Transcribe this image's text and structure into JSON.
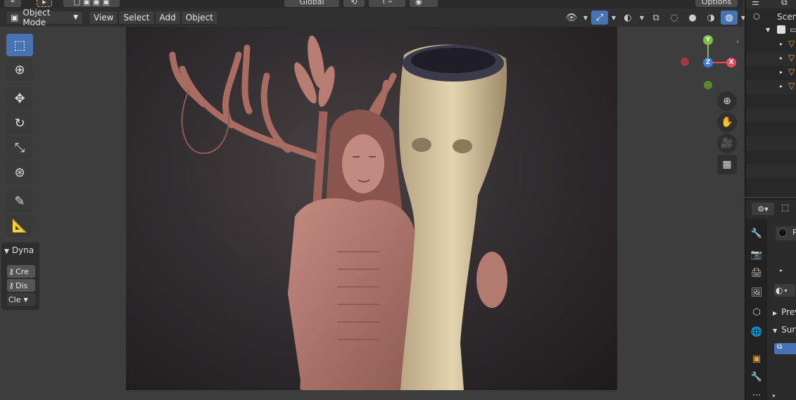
{
  "top_strip": {
    "transform_label": "Global",
    "options_label": "Options"
  },
  "header": {
    "mode_label": "Object Mode",
    "menus": [
      "View",
      "Select",
      "Add",
      "Object"
    ]
  },
  "toolbar": {
    "tools": [
      "select-box",
      "cursor",
      "move",
      "rotate",
      "scale",
      "transform",
      "annotate",
      "measure"
    ],
    "active_tool": "select-box"
  },
  "operator_panel": {
    "title": "Dyna",
    "buttons": [
      "Cre",
      "Dis"
    ],
    "dropdown": "Cle"
  },
  "gizmo": {
    "y_label": "Y",
    "z_label": "Z",
    "x_label": "X",
    "colors": {
      "x": "#e84a5f",
      "y": "#7bc043",
      "z": "#3b7dd8"
    }
  },
  "outliner": {
    "scene_label": "Scene"
  },
  "properties": {
    "panels": [
      "Prev",
      "Surf"
    ],
    "material_slot": "P"
  },
  "colors": {
    "accent": "#4772b3",
    "background": "#303030"
  }
}
